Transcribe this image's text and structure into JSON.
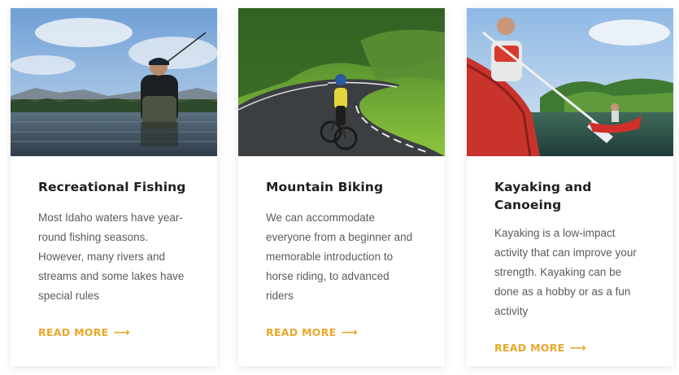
{
  "theme": {
    "accent": "#e8a728",
    "title_color": "#1f1f1f",
    "text_color": "#5b5b5b"
  },
  "cards": [
    {
      "title": "Recreational Fishing",
      "description": "Most Idaho waters have year-round fishing seasons. However, many rivers and streams and some lakes have special rules",
      "read_more": "READ MORE",
      "arrow_icon": "arrow-right-icon",
      "image": "fisherman-in-lake-photo"
    },
    {
      "title": "Mountain Biking",
      "description": "We can accommodate everyone from a beginner and memorable introduction to horse riding, to advanced riders",
      "read_more": "READ MORE",
      "arrow_icon": "arrow-right-icon",
      "image": "cyclist-on-mountain-road-photo"
    },
    {
      "title": "Kayaking and Canoeing",
      "description": "Kayaking is a low-impact activity that can improve your strength. Kayaking can be done as a hobby or as a fun activity",
      "read_more": "READ MORE",
      "arrow_icon": "arrow-right-icon",
      "image": "kayakers-on-river-photo"
    }
  ]
}
